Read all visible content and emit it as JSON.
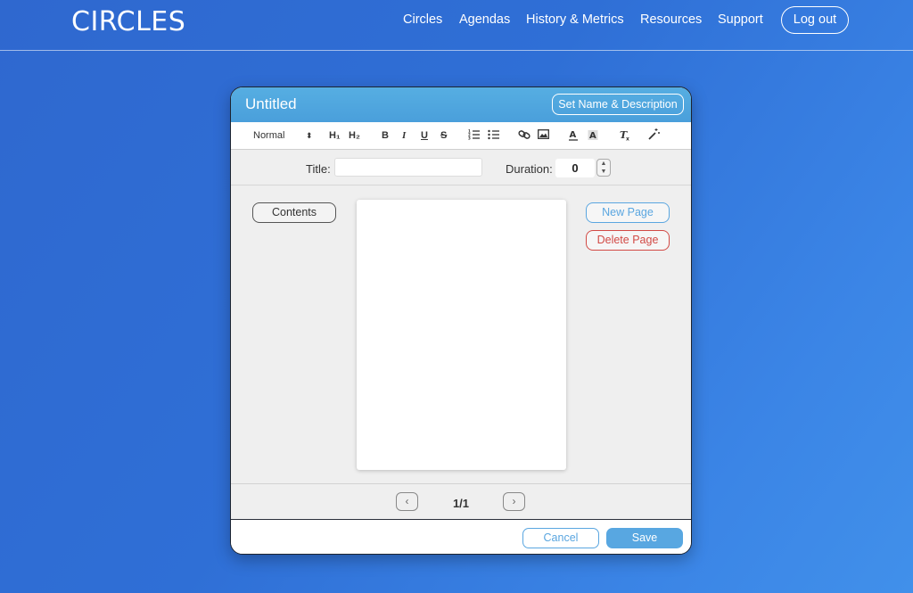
{
  "header": {
    "logo": "CIRCLES",
    "nav": [
      "Circles",
      "Agendas",
      "History & Metrics",
      "Resources",
      "Support"
    ],
    "logout_label": "Log out"
  },
  "modal": {
    "title": "Untitled",
    "set_name_label": "Set Name & Description",
    "toolbar": {
      "format_value": "Normal",
      "select_arrows": "⬍",
      "h1": "H₁",
      "h2": "H₂",
      "bold": "B",
      "italic": "I",
      "underline": "U",
      "strike": "S",
      "icons": [
        "ordered-list-icon",
        "bullet-list-icon",
        "link-icon",
        "image-icon",
        "font-color-icon",
        "background-color-icon",
        "clear-format-icon",
        "magic-wand-icon"
      ]
    },
    "fields": {
      "title_label": "Title:",
      "title_value": "",
      "duration_label": "Duration:",
      "duration_value": "0"
    },
    "contents_label": "Contents",
    "new_page_label": "New Page",
    "delete_page_label": "Delete Page",
    "pager": {
      "count": "1/1",
      "prev": "‹",
      "next": "›"
    },
    "footer": {
      "cancel_label": "Cancel",
      "save_label": "Save"
    }
  },
  "colors": {
    "accent": "#58a7e1",
    "danger": "#d24a45",
    "background": "#2f6fd6"
  }
}
